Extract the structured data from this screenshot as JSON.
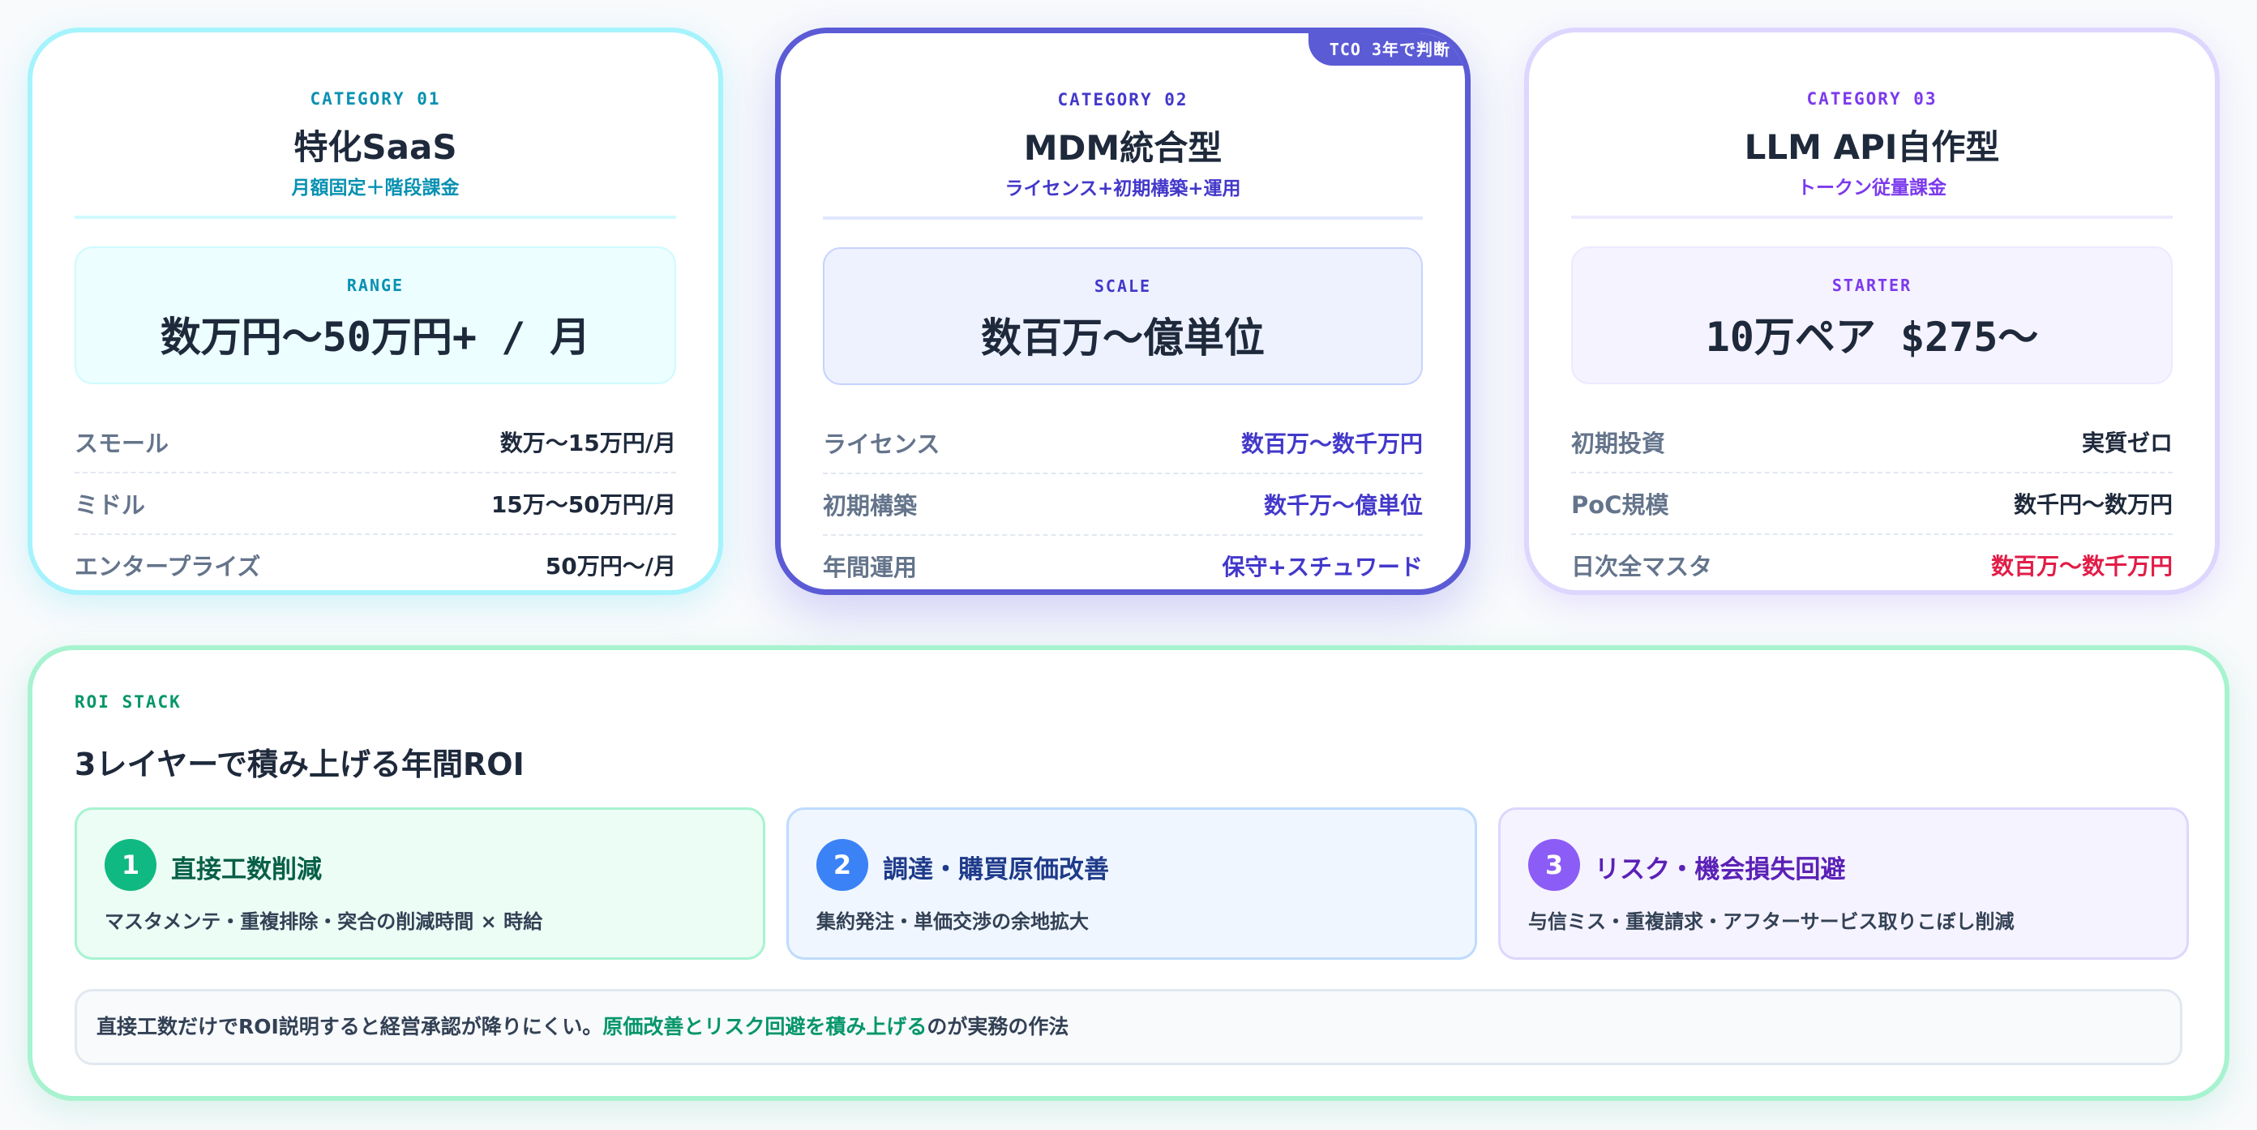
{
  "categories": [
    {
      "label": "CATEGORY 01",
      "title": "特化SaaS",
      "subtitle": "月額固定＋階段課金",
      "box_label": "RANGE",
      "box_value": "数万円〜50万円+ / 月",
      "rows": [
        {
          "key": "スモール",
          "value": "数万〜15万円/月"
        },
        {
          "key": "ミドル",
          "value": "15万〜50万円/月"
        },
        {
          "key": "エンタープライズ",
          "value": "50万円〜/月"
        }
      ],
      "accent": "#0891b2"
    },
    {
      "label": "CATEGORY 02",
      "title": "MDM統合型",
      "subtitle": "ライセンス+初期構築+運用",
      "badge": "TCO 3年で判断",
      "box_label": "SCALE",
      "box_value": "数百万〜億単位",
      "rows": [
        {
          "key": "ライセンス",
          "value": "数百万〜数千万円"
        },
        {
          "key": "初期構築",
          "value": "数千万〜億単位"
        },
        {
          "key": "年間運用",
          "value": "保守+スチュワード"
        }
      ],
      "accent": "#4338ca"
    },
    {
      "label": "CATEGORY 03",
      "title": "LLM API自作型",
      "subtitle": "トークン従量課金",
      "box_label": "STARTER",
      "box_value": "10万ペア $275〜",
      "rows": [
        {
          "key": "初期投資",
          "value": "実質ゼロ"
        },
        {
          "key": "PoC規模",
          "value": "数千円〜数万円"
        },
        {
          "key": "日次全マスタ",
          "value": "数百万〜数千万円"
        }
      ],
      "accent": "#7c3aed",
      "warning": "#e11d48"
    }
  ],
  "roi": {
    "label": "ROI STACK",
    "title": "3レイヤーで積み上げる年間ROI",
    "layers": [
      {
        "num": "1",
        "title": "直接工数削減",
        "desc": "マスタメンテ・重複排除・突合の削減時間 × 時給",
        "color": "#10b981"
      },
      {
        "num": "2",
        "title": "調達・購買原価改善",
        "desc": "集約発注・単価交渉の余地拡大",
        "color": "#3b82f6"
      },
      {
        "num": "3",
        "title": "リスク・機会損失回避",
        "desc": "与信ミス・重複請求・アフターサービス取りこぼし削減",
        "color": "#8b5cf6"
      }
    ],
    "note_prefix": "直接工数だけでROI説明すると経営承認が降りにくい。",
    "note_highlight": "原価改善とリスク回避を積み上げる",
    "note_suffix": "のが実務の作法"
  }
}
